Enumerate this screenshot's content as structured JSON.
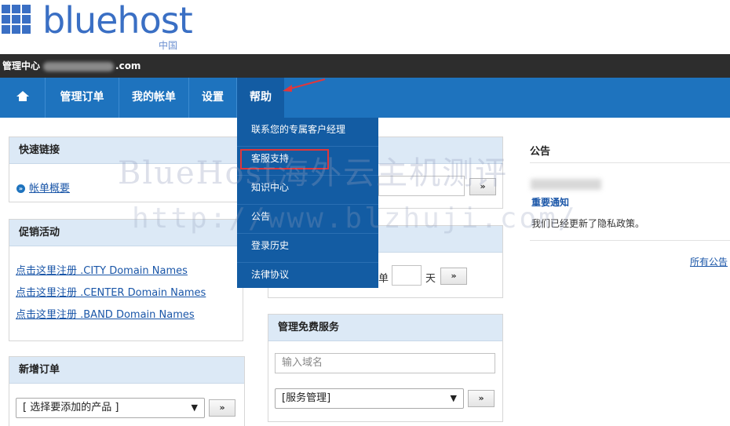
{
  "logo": {
    "name": "bluehost",
    "sub": "中国"
  },
  "account": {
    "label": "管理中心",
    "email_domain": ".com"
  },
  "nav": {
    "home_icon": "home-icon",
    "items": [
      {
        "label": "管理订单"
      },
      {
        "label": "我的帐单"
      },
      {
        "label": "设置"
      },
      {
        "label": "帮助"
      }
    ]
  },
  "help_menu": {
    "items": [
      {
        "label": "联系您的专属客户经理"
      },
      {
        "label": "客服支持"
      },
      {
        "label": "知识中心"
      },
      {
        "label": "公告"
      },
      {
        "label": "登录历史"
      },
      {
        "label": "法律协议"
      }
    ]
  },
  "quick_links": {
    "title": "快速链接",
    "items": [
      {
        "label": "帐单概要"
      }
    ]
  },
  "promotions": {
    "title": "促销活动",
    "items": [
      {
        "label": "点击这里注册 .CITY Domain Names"
      },
      {
        "label": "点击这里注册 .CENTER Domain Names"
      },
      {
        "label": "点击这里注册 .BAND Domain Names"
      }
    ]
  },
  "new_order": {
    "title": "新增订单",
    "select_value": "[ 选择要添加的产品 ]",
    "go": "»"
  },
  "middle_top": {
    "go": "»"
  },
  "middle_bill": {
    "unit_left": "单",
    "unit_right": "天",
    "go": "»"
  },
  "free_services": {
    "title": "管理免费服务",
    "input_placeholder": "输入域名",
    "select_value": "[服务管理]",
    "go": "»"
  },
  "announcements": {
    "title": "公告",
    "item_title": "重要通知",
    "item_text": "我们已经更新了隐私政策。",
    "all_link": "所有公告"
  },
  "watermark": {
    "brand": "BlueHost海外云主机测评",
    "url": "http://www.blzhuji.com/"
  },
  "colors": {
    "nav": "#1e73be",
    "nav_active": "#135ca3",
    "panel_head": "#dce9f6",
    "link": "#1a56a8",
    "highlight": "#e0373b"
  }
}
